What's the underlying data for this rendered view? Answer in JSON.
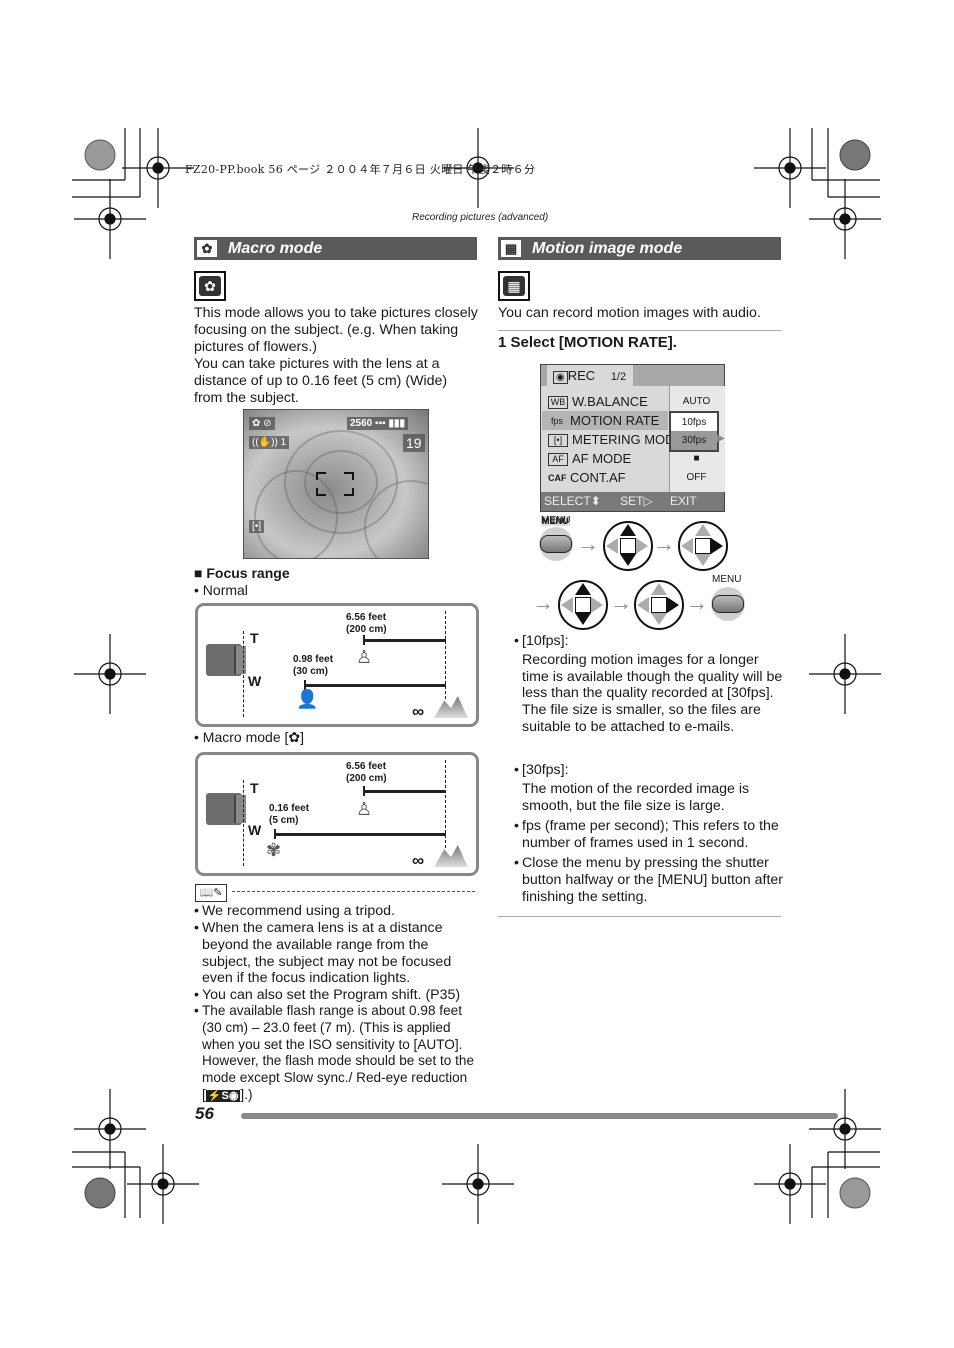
{
  "print_header": {
    "text": "FZ20-PP.book  56 ページ  ２００４年７月６日  火曜日  午後２時６分"
  },
  "running_head": "Recording pictures (advanced)",
  "left_column": {
    "section_title": "Macro mode",
    "section_icon": "macro-flower-icon",
    "intro_paragraphs": [
      "This mode allows you to take pictures closely focusing on the subject. (e.g. When taking pictures of flowers.)",
      "You can take pictures with the lens at a distance of up to 0.16 feet (5 cm) (Wide) from the subject."
    ],
    "lcd_preview": {
      "resolution": "2560",
      "remaining_shots": "19",
      "stabilizer_mode": "1",
      "mode_icons": [
        "macro-flower-icon",
        "flash-off-icon"
      ],
      "quality_icon": "quality-fine-icon",
      "battery_icon": "battery-full-icon",
      "metering_icon": "spot-metering-icon"
    },
    "focus_range": {
      "heading": "Focus range",
      "normal_label": "Normal",
      "macro_label_prefix": "Macro mode [",
      "macro_label_suffix": "]",
      "normal_diagram": {
        "tele_label": "T",
        "wide_label": "W",
        "tele_distance_ft": "6.56 feet",
        "tele_distance_cm": "(200 cm)",
        "wide_distance_ft": "0.98 feet",
        "wide_distance_cm": "(30 cm)",
        "infinity": "∞"
      },
      "macro_diagram": {
        "tele_label": "T",
        "wide_label": "W",
        "tele_distance_ft": "6.56 feet",
        "tele_distance_cm": "(200 cm)",
        "wide_distance_ft": "0.16 feet",
        "wide_distance_cm": "(5 cm)",
        "infinity": "∞"
      }
    },
    "notes": [
      "We recommend using a tripod.",
      "When the camera lens is at a distance beyond the available range from the subject, the subject may not be focused even if the focus indication lights.",
      "You can also set the Program shift. (P35)",
      "The available flash range is about 0.98 feet (30 cm) – 23.0 feet (7 m). (This is applied when you set the ISO sensitivity to [AUTO]. However, the flash mode should be set to the mode except Slow sync./ Red-eye reduction [",
      "].)"
    ],
    "flash_badge": "⚡S◉"
  },
  "right_column": {
    "section_title": "Motion image mode",
    "section_icon": "film-strip-icon",
    "intro": "You can record motion images with audio.",
    "step_number": "1",
    "step_text": "Select [MOTION RATE].",
    "menu": {
      "tab_label": "REC",
      "page_indicator": "1/2",
      "rows": [
        {
          "icon": "WB",
          "label": "W.BALANCE",
          "value": "AUTO"
        },
        {
          "icon": "fps",
          "label": "MOTION RATE",
          "value": "10fps"
        },
        {
          "icon": "[•]",
          "label": "METERING MODE",
          "value": "30fps"
        },
        {
          "icon": "AF",
          "label": "AF MODE",
          "value": "■"
        },
        {
          "icon": "CAF",
          "label": "CONT.AF",
          "value": "OFF"
        }
      ],
      "footer": {
        "select": "SELECT",
        "set": "SET",
        "exit": "EXIT",
        "menu_key": "MENU"
      }
    },
    "sequence_labels": {
      "menu_start": "MENU",
      "menu_end": "MENU"
    },
    "bullets": [
      {
        "head": "[10fps]:",
        "body": "Recording motion images for a longer time is available though the quality will be less than the quality recorded at [30fps]. The file size is smaller, so the files are suitable to be attached to e-mails."
      },
      {
        "head": "[30fps]:",
        "body": "The motion of the recorded image is smooth, but the file size is large."
      },
      {
        "head": "",
        "body": "fps (frame per second); This refers to the number of frames used in 1 second."
      },
      {
        "head": "",
        "body": "Close the menu by pressing the shutter button halfway or the [MENU] button after finishing the setting."
      }
    ]
  },
  "footer": {
    "page_number": "56"
  }
}
